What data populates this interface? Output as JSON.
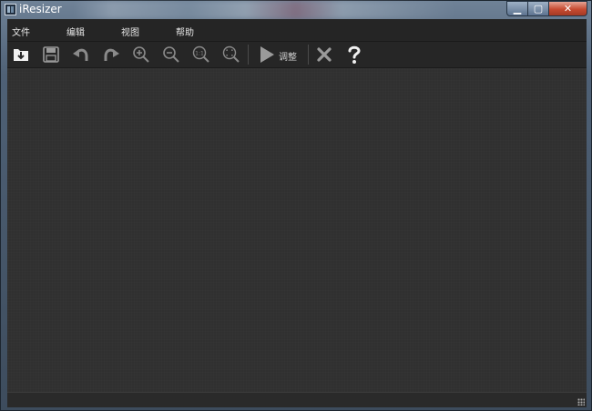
{
  "window": {
    "title": "iResizer",
    "buttons": {
      "minimize": "▁",
      "maximize": "▢",
      "close": "✕"
    }
  },
  "menu": {
    "items": [
      "文件",
      "编辑",
      "视图",
      "帮助"
    ]
  },
  "toolbar": {
    "buttons": [
      {
        "name": "open-icon"
      },
      {
        "name": "save-icon"
      },
      {
        "name": "undo-icon"
      },
      {
        "name": "redo-icon"
      },
      {
        "name": "zoom-in-icon"
      },
      {
        "name": "zoom-out-icon"
      },
      {
        "name": "actual-size-icon",
        "text": "1:1"
      },
      {
        "name": "fit-icon"
      },
      {
        "name": "play-icon"
      },
      {
        "name": "close-icon"
      },
      {
        "name": "help-icon"
      }
    ],
    "adjust_label": "调整"
  }
}
